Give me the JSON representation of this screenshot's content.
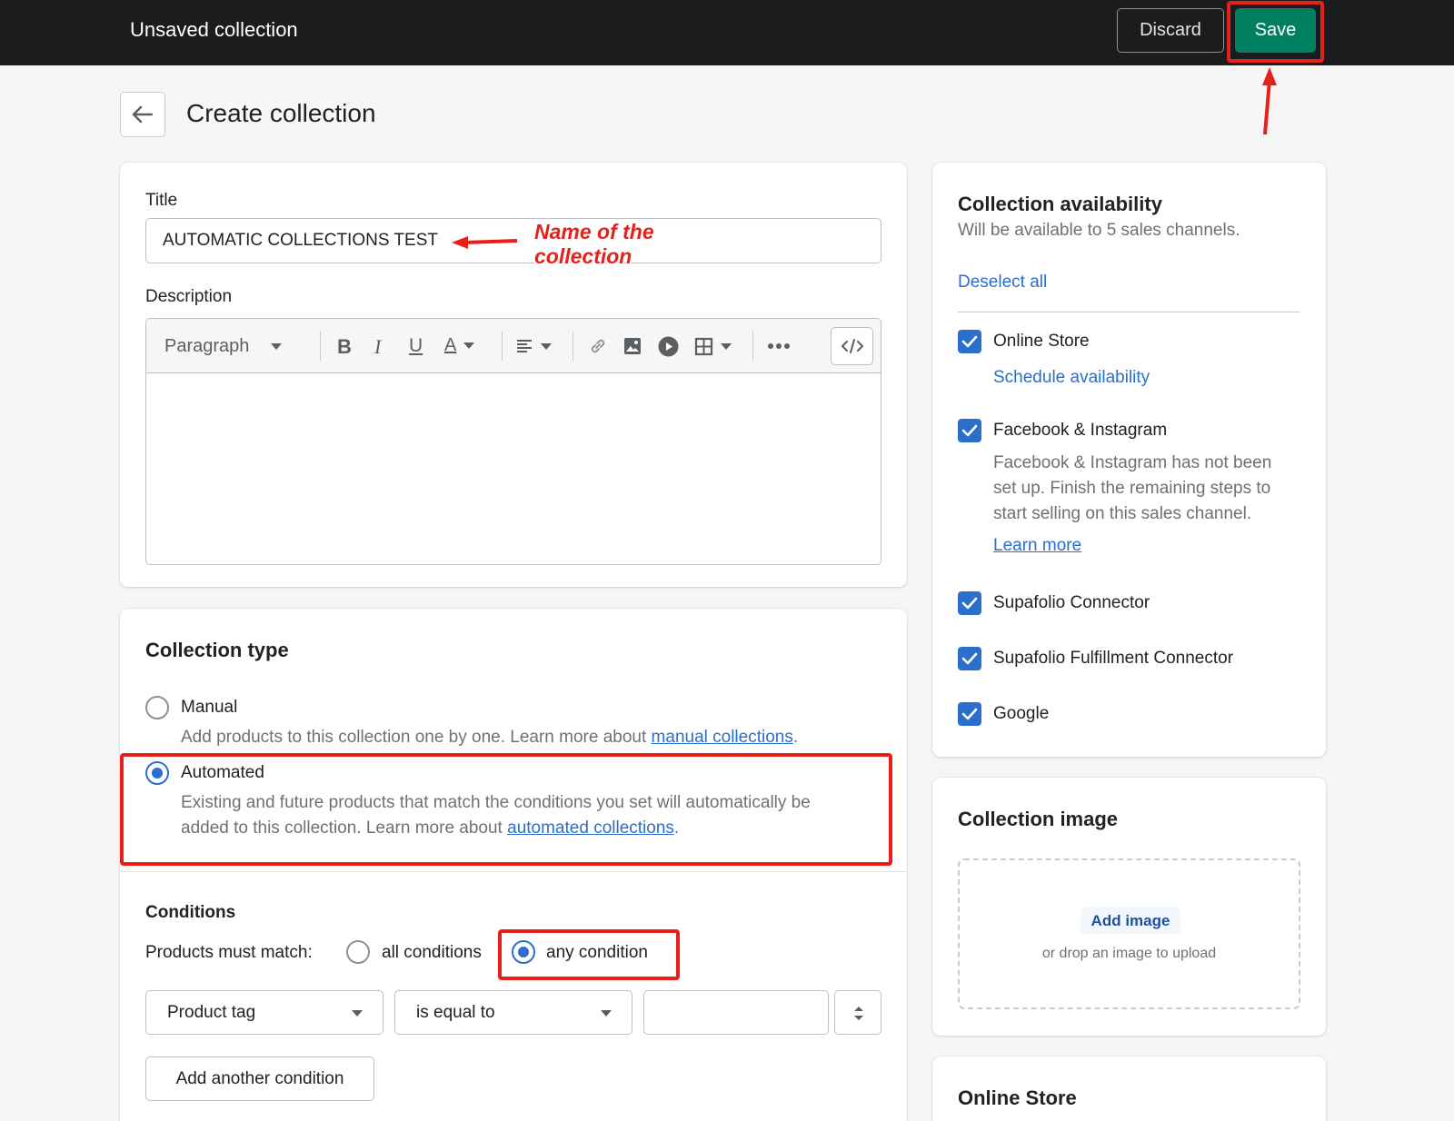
{
  "topbar": {
    "title": "Unsaved collection",
    "discard_label": "Discard",
    "save_label": "Save"
  },
  "page": {
    "title": "Create collection"
  },
  "details": {
    "title_label": "Title",
    "title_value": "AUTOMATIC COLLECTIONS TEST",
    "description_label": "Description",
    "editor": {
      "paragraph_label": "Paragraph",
      "bold": "B",
      "italic": "I",
      "underline": "U",
      "text_color": "A"
    }
  },
  "annotations": {
    "title_note_line1": "Name of the",
    "title_note_line2": "collection"
  },
  "collection_type": {
    "heading": "Collection type",
    "manual_label": "Manual",
    "manual_desc": "Add products to this collection one by one. Learn more about ",
    "manual_link": "manual collections",
    "automated_label": "Automated",
    "automated_desc_1": "Existing and future products that match the conditions you set will automatically be",
    "automated_desc_2": "added to this collection. Learn more about ",
    "automated_link": "automated collections",
    "selected": "Automated"
  },
  "conditions": {
    "heading": "Conditions",
    "match_label": "Products must match:",
    "all_label": "all conditions",
    "any_label": "any condition",
    "selected": "any condition",
    "rule": {
      "field": "Product tag",
      "operator": "is equal to",
      "value": ""
    },
    "add_label": "Add another condition"
  },
  "availability": {
    "heading": "Collection availability",
    "subtitle": "Will be available to 5 sales channels.",
    "deselect_all": "Deselect all",
    "channels": [
      {
        "name": "Online Store",
        "checked": true,
        "link": "Schedule availability"
      },
      {
        "name": "Facebook & Instagram",
        "checked": true,
        "note_1": "Facebook & Instagram has not been",
        "note_2": "set up. Finish the remaining steps to",
        "note_3": "start selling on this sales channel.",
        "link": "Learn more"
      },
      {
        "name": "Supafolio Connector",
        "checked": true
      },
      {
        "name": "Supafolio Fulfillment Connector",
        "checked": true
      },
      {
        "name": "Google",
        "checked": true
      }
    ]
  },
  "collection_image": {
    "heading": "Collection image",
    "add_label": "Add image",
    "drop_hint": "or drop an image to upload"
  },
  "online_store": {
    "heading": "Online Store"
  },
  "colors": {
    "topbar": "#1a1c1d",
    "primary": "#008060",
    "link": "#2c6ecb",
    "annotation": "#e8201a"
  }
}
